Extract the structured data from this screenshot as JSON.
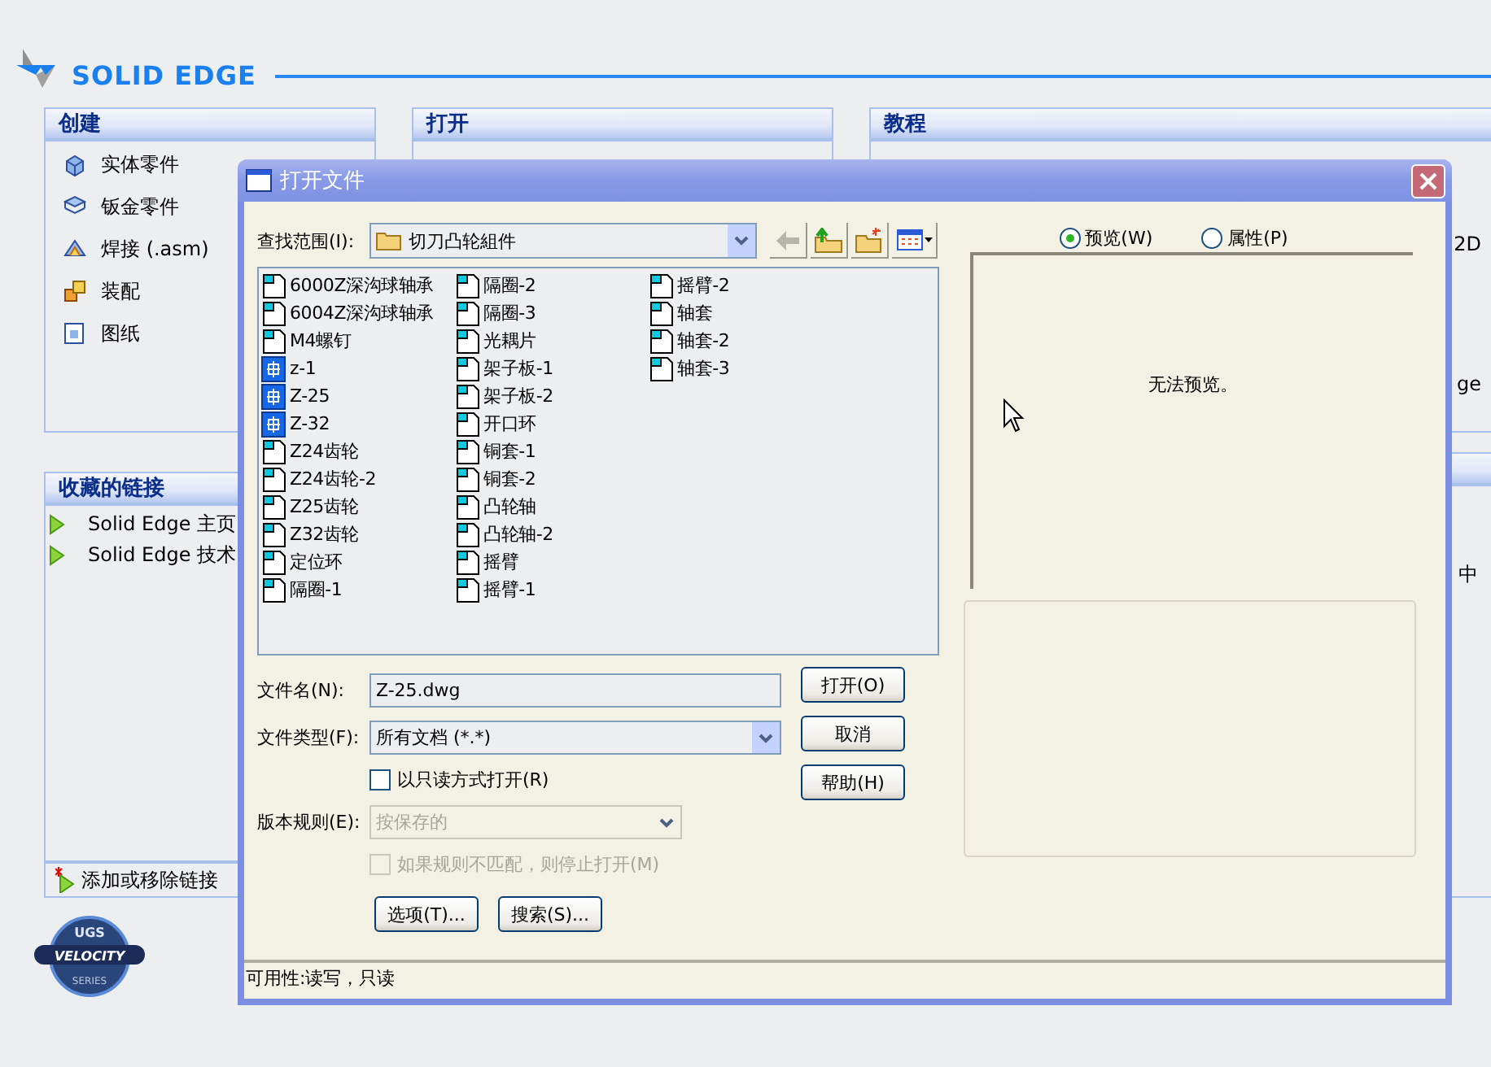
{
  "header": {
    "logo": "SOLID EDGE"
  },
  "create_panel": {
    "title": "创建",
    "items": [
      {
        "label": "实体零件",
        "kind": "part"
      },
      {
        "label": "钣金零件",
        "kind": "sheet"
      },
      {
        "label": "焊接 (.asm)",
        "kind": "weld"
      },
      {
        "label": "装配",
        "kind": "assembly"
      },
      {
        "label": "图纸",
        "kind": "draft"
      }
    ]
  },
  "open_panel": {
    "title": "打开"
  },
  "tutorial_panel": {
    "title": "教程",
    "lines": [
      "2D",
      "ge"
    ]
  },
  "right_lower_panel": {
    "lines": [
      "中"
    ]
  },
  "favorites_panel": {
    "title": "收藏的链接",
    "links": [
      "Solid Edge 主页",
      "Solid Edge 技术"
    ],
    "footer": "添加或移除链接"
  },
  "badge": {
    "texts": [
      "UGS",
      "VELOCITY",
      "SERIES"
    ]
  },
  "dialog": {
    "title": "打开文件",
    "look_in_label": "查找范围(I):",
    "look_in": "切刀凸轮組件",
    "files": [
      {
        "name": "6000Z深沟球轴承",
        "kind": "part"
      },
      {
        "name": "6004Z深沟球轴承",
        "kind": "part"
      },
      {
        "name": "M4螺钉",
        "kind": "part"
      },
      {
        "name": "z-1",
        "kind": "drawing"
      },
      {
        "name": "Z-25",
        "kind": "drawing"
      },
      {
        "name": "Z-32",
        "kind": "drawing"
      },
      {
        "name": "Z24齿轮",
        "kind": "part"
      },
      {
        "name": "Z24齿轮-2",
        "kind": "part"
      },
      {
        "name": "Z25齿轮",
        "kind": "part"
      },
      {
        "name": "Z32齿轮",
        "kind": "part"
      },
      {
        "name": "定位环",
        "kind": "part"
      },
      {
        "name": "隔圈-1",
        "kind": "part"
      },
      {
        "name": "隔圈-2",
        "kind": "part"
      },
      {
        "name": "隔圈-3",
        "kind": "part"
      },
      {
        "name": "光耦片",
        "kind": "part"
      },
      {
        "name": "架子板-1",
        "kind": "part"
      },
      {
        "name": "架子板-2",
        "kind": "part"
      },
      {
        "name": "开口环",
        "kind": "part"
      },
      {
        "name": "铜套-1",
        "kind": "part"
      },
      {
        "name": "铜套-2",
        "kind": "part"
      },
      {
        "name": "凸轮轴",
        "kind": "part"
      },
      {
        "name": "凸轮轴-2",
        "kind": "part"
      },
      {
        "name": "摇臂",
        "kind": "part"
      },
      {
        "name": "摇臂-1",
        "kind": "part"
      },
      {
        "name": "摇臂-2",
        "kind": "part"
      },
      {
        "name": "轴套",
        "kind": "part"
      },
      {
        "name": "轴套-2",
        "kind": "part"
      },
      {
        "name": "轴套-3",
        "kind": "part"
      }
    ],
    "view_tabs": [
      {
        "label": "预览(W)",
        "selected": true
      },
      {
        "label": "属性(P)",
        "selected": false
      }
    ],
    "preview_message": "无法预览。",
    "file_name_label": "文件名(N):",
    "file_name": "Z-25.dwg",
    "file_type_label": "文件类型(F):",
    "file_type": "所有文档 (*.*)",
    "read_only": {
      "label": "以只读方式打开(R)",
      "checked": false
    },
    "version_label": "版本规则(E):",
    "version": {
      "value": "按保存的",
      "disabled": true
    },
    "stop_if_mismatch": {
      "label": "如果规则不匹配，则停止打开(M)",
      "checked": false,
      "disabled": true
    },
    "buttons": [
      "打开(O)",
      "取消",
      "帮助(H)"
    ],
    "extra_buttons": [
      "选项(T)...",
      "搜索(S)..."
    ],
    "status": "可用性:读写，只读"
  }
}
